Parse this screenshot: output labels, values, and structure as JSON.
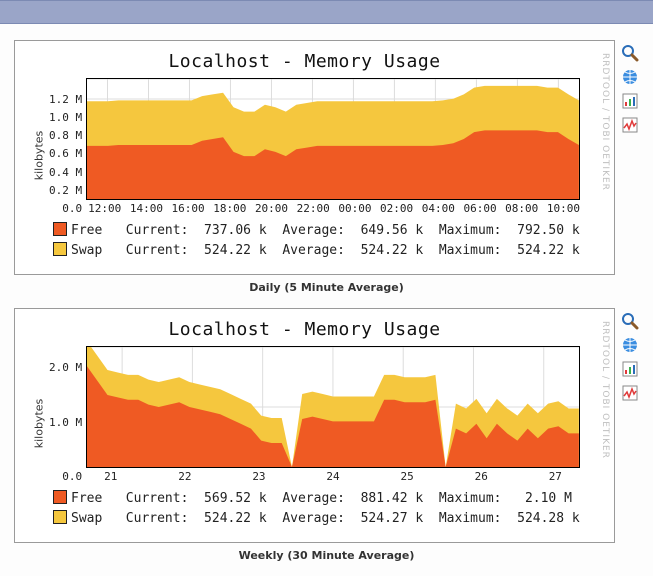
{
  "colors": {
    "free": "#ef5a23",
    "swap": "#f5c73e"
  },
  "tools": {
    "zoom": "zoom-icon",
    "globe": "globe-icon",
    "chart": "chart-icon",
    "activity": "activity-icon"
  },
  "chart_data": [
    {
      "id": "daily",
      "type": "area",
      "title": "Localhost - Memory Usage",
      "ylabel": "kilobytes",
      "caption": "Daily (5 Minute Average)",
      "watermark": "RRDTOOL / TOBI OETIKER",
      "ylim": [
        0.0,
        1.4
      ],
      "y_unit_suffix": " M",
      "yticks": [
        "1.2 M",
        "1.0 M",
        "0.8 M",
        "0.6 M",
        "0.4 M",
        "0.2 M",
        "0.0"
      ],
      "xticks": [
        "12:00",
        "14:00",
        "16:00",
        "18:00",
        "20:00",
        "22:00",
        "00:00",
        "02:00",
        "04:00",
        "06:00",
        "08:00",
        "10:00"
      ],
      "series": [
        {
          "name": "Free",
          "color": "#ef5a23",
          "values": [
            0.62,
            0.62,
            0.62,
            0.63,
            0.63,
            0.63,
            0.63,
            0.63,
            0.63,
            0.63,
            0.63,
            0.68,
            0.7,
            0.72,
            0.55,
            0.5,
            0.5,
            0.58,
            0.55,
            0.5,
            0.58,
            0.6,
            0.62,
            0.62,
            0.62,
            0.62,
            0.62,
            0.62,
            0.62,
            0.62,
            0.62,
            0.62,
            0.62,
            0.62,
            0.63,
            0.65,
            0.7,
            0.78,
            0.8,
            0.8,
            0.8,
            0.8,
            0.8,
            0.8,
            0.78,
            0.78,
            0.7,
            0.63
          ],
          "stats": {
            "Current": "737.06 k",
            "Average": "649.56 k",
            "Maximum": "792.50 k"
          }
        },
        {
          "name": "Swap",
          "color": "#f5c73e",
          "values": [
            0.52,
            0.52,
            0.52,
            0.52,
            0.52,
            0.52,
            0.52,
            0.52,
            0.52,
            0.52,
            0.52,
            0.52,
            0.52,
            0.52,
            0.52,
            0.52,
            0.52,
            0.52,
            0.52,
            0.52,
            0.52,
            0.52,
            0.52,
            0.52,
            0.52,
            0.52,
            0.52,
            0.52,
            0.52,
            0.52,
            0.52,
            0.52,
            0.52,
            0.52,
            0.52,
            0.52,
            0.52,
            0.52,
            0.52,
            0.52,
            0.52,
            0.52,
            0.52,
            0.52,
            0.52,
            0.52,
            0.52,
            0.52
          ],
          "stats": {
            "Current": "524.22 k",
            "Average": "524.22 k",
            "Maximum": "524.22 k"
          }
        }
      ],
      "legend_lines": [
        {
          "swatch": "free",
          "name": "Free",
          "text": "Current:  737.06 k  Average:  649.56 k  Maximum:  792.50 k"
        },
        {
          "swatch": "swap",
          "name": "Swap",
          "text": "Current:  524.22 k  Average:  524.22 k  Maximum:  524.22 k"
        }
      ]
    },
    {
      "id": "weekly",
      "type": "area",
      "title": "Localhost - Memory Usage",
      "ylabel": "kilobytes",
      "caption": "Weekly (30 Minute Average)",
      "watermark": "RRDTOOL / TOBI OETIKER",
      "ylim": [
        0.0,
        2.5
      ],
      "y_unit_suffix": " M",
      "yticks": [
        "2.0 M",
        "1.0 M",
        "0.0"
      ],
      "xticks": [
        "21",
        "22",
        "23",
        "24",
        "25",
        "26",
        "27"
      ],
      "series": [
        {
          "name": "Free",
          "color": "#ef5a23",
          "values": [
            2.1,
            1.8,
            1.5,
            1.45,
            1.4,
            1.4,
            1.3,
            1.25,
            1.3,
            1.35,
            1.25,
            1.2,
            1.15,
            1.1,
            1.0,
            0.9,
            0.8,
            0.55,
            0.5,
            0.5,
            0.0,
            1.0,
            1.05,
            1.0,
            0.95,
            0.95,
            0.95,
            0.95,
            0.95,
            1.4,
            1.4,
            1.35,
            1.35,
            1.35,
            1.4,
            0.0,
            0.8,
            0.7,
            0.9,
            0.6,
            0.9,
            0.7,
            0.55,
            0.8,
            0.6,
            0.8,
            0.85,
            0.7,
            0.7
          ],
          "stats": {
            "Current": "569.52 k",
            "Average": "881.42 k",
            "Maximum": "2.10 M"
          }
        },
        {
          "name": "Swap",
          "color": "#f5c73e",
          "values": [
            0.52,
            0.52,
            0.52,
            0.52,
            0.52,
            0.52,
            0.52,
            0.52,
            0.52,
            0.52,
            0.52,
            0.52,
            0.52,
            0.52,
            0.52,
            0.52,
            0.52,
            0.52,
            0.52,
            0.52,
            0.0,
            0.52,
            0.52,
            0.52,
            0.52,
            0.52,
            0.52,
            0.52,
            0.52,
            0.52,
            0.52,
            0.52,
            0.52,
            0.52,
            0.52,
            0.0,
            0.52,
            0.52,
            0.52,
            0.52,
            0.52,
            0.52,
            0.52,
            0.52,
            0.52,
            0.52,
            0.52,
            0.52,
            0.52
          ],
          "stats": {
            "Current": "524.22 k",
            "Average": "524.27 k",
            "Maximum": "524.28 k"
          }
        }
      ],
      "legend_lines": [
        {
          "swatch": "free",
          "name": "Free",
          "text": "Current:  569.52 k  Average:  881.42 k  Maximum:   2.10 M"
        },
        {
          "swatch": "swap",
          "name": "Swap",
          "text": "Current:  524.22 k  Average:  524.27 k  Maximum:  524.28 k"
        }
      ]
    }
  ]
}
